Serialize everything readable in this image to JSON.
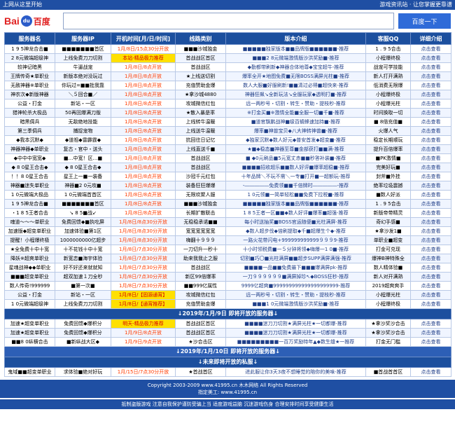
{
  "topbar": {
    "left": "上网从这里开始",
    "right": "游戏资讯站 · 让您掌握更靠谱"
  },
  "search": {
    "logo_bai": "Bai",
    "logo_paw": "du",
    "logo_du": "百度",
    "button": "百度一下",
    "placeholder": ""
  },
  "table": {
    "headers": [
      "服务器名",
      "服务器IP",
      "开机时间[月/日/时间]",
      "线路类别",
      "版本介绍",
      "客服QQ",
      "详细介绍"
    ],
    "rows": [
      [
        "1 9 5神龙合击■",
        "■■■■■■■首区",
        "1月/8日/15点30分开放",
        "■■■沙城独金",
        "■■■■■独家版本■■品牌版■■■■■■-推荐",
        "1 . 9 5合击",
        "点击查看"
      ],
      [
        "2 8元微端超级神",
        "上线免费刀刀切割",
        "本站-精品极力推荐",
        "首战战区首区",
        "■■■2 8元微端激情版沙洪奖励■-推荐",
        "小程爆终极",
        "点击查看"
      ],
      [
        "较神记暗黑",
        "牛逼战宠",
        "1月/8日/8点开放",
        "首战战区",
        "◆勤都带刷新◆神器合体地尊◆宝宝超牛-推荐",
        "战宠可学技能",
        "点击查看"
      ],
      [
        "王牌传奇★单职业",
        "新版本绝对没玩过",
        "1月/8日/8点开放",
        "★上线送切割",
        "爆率全开★地图免费■无限BOSS满屏光柱■-推荐",
        "新人打开满熟",
        "点击查看"
      ],
      [
        "无赦神器※单职业",
        "你玩过=■■批我靠",
        "1月/8日/8点开放",
        "充值赞助金爆",
        "数人大服■好服刷新!■■清过必得■超快来-推荐",
        "低消费无限爆",
        "点击查看"
      ],
      [
        "神农次◆新版神器",
        "＼５回合■／",
        "1月/8日/8点开放",
        "★拿沙城4880",
        "神器狂飙↘全新玩法↘全服玩家◆透明打■-推荐",
        "小程爆终极",
        "点击查看"
      ],
      [
        "公益・打金",
        "新站・一区",
        "1月/8日/8点开放",
        "攻城微信红包",
        "远一两秒号・切割・转生・赞助・提枝秒-推荐",
        "小程爆光柱",
        "点击查看"
      ],
      [
        "猎神轮杀大极品",
        "50再回爆满刀版",
        "1月/8日/8点开放",
        "★散入暴是率",
        "※打金买■※激情全能■全服一切■千■-推荐",
        "时间换取一切",
        "点击查看"
      ],
      [
        "暗黑倜兵",
        "无敌绝地技能",
        "1月/8日/8点开放",
        "上线转牛温暖",
        "■道官飘鹏战神■级百蜻蜂速加持■-推荐",
        "■ 8倍充值■",
        "点击查看"
      ],
      [
        "第三季倜兵",
        "捕捉宠物",
        "1月/8日/8点开放",
        "上线送牛温暖",
        "爆率■神兽宝贝◆八大神转神兽■-推荐",
        "火爆人气",
        "点击查看"
      ],
      [
        "◆我本沉默◆",
        "◆道祖◆雷霹霆◆",
        "1月/8日/8点开放",
        "抗回往日记忆",
        "◆独家沉默◆数人好元◆普安首发◆超变■-推荐",
        "稳定长期顺玩",
        "点击查看"
      ],
      [
        "神器神器◆单职业",
        "复古・官中・送头",
        "1月/8日/8点开放",
        "上线直送千■",
        "★■◆稳态■神器至尊■金部获打■■满-推荐",
        "提升百倍爆率",
        "点击查看"
      ],
      [
        "◆中中中宽宽◆",
        "■…中宽！区…■",
        "1月/8日/8点开放",
        "首战战区",
        "■ ◆0元刷品■5元宽丈赤■■秒答补装■-推荐",
        "■PK激情■",
        "点击查看"
      ],
      [
        "◆ 8 0星王合击◆",
        "◆ 8 0星王合击◆",
        "1月/8日/8点开放",
        "首战战区",
        "■■■■招收超乐■■数人好评■爆率超稳■-推荐",
        "完美好玩■",
        "点击查看"
      ],
      [
        "！！8 0星王合击",
        "星王上一■一装备",
        "1月/8日/8点开放",
        "沙冠千元红包",
        "十年品牌＼不玩不需＼一专■打开■一超额玩-推荐",
        "封斧■外挂",
        "点击查看"
      ],
      [
        "神器■迷失单职业",
        "神器■2 0元攻■",
        "1月/8日/8点开放",
        "装备狂狂爆爆",
        "-―――――免费领■■千倍牌时―――――-推荐",
        "绝率垃圾震撼",
        "点击查看"
      ],
      [
        "1 0元微端大极品",
        "1 0元微端首首区",
        "1月/8日/8点开放",
        "无限欢聚人服",
        "1 0元领■一简单轻松■■免费下拉税■-推荐",
        "■数人好派",
        "点击查看"
      ],
      [
        "1 9 5神龙合击■",
        "■■■■■■■首区",
        "1月/8日/8点开放",
        "■■■沙城独金",
        "■■■■■独家版本■■品牌版■■■■■■-推荐",
        "1 . 9 5合击",
        "点击查看"
      ],
      [
        "・1 8 5王者合击",
        "↘ 8 5■战↙",
        "1月/8日/8点开放",
        "长期扩散联击",
        "1 8 5王者一区■■◆数人好评■爆率■超强-推荐",
        "新版帝带精灵",
        "点击查看"
      ],
      [
        "魂道～～～单职业",
        "免费回馈◆■执吃屏",
        "1月/8日/8点30分开放",
        "无稳稳承诺■■",
        "每小时送抽奖■BOSS官运随便■光柱满屏-推荐",
        "奇幻手感■",
        "点击查看"
      ],
      [
        "加速版◆超变单职业",
        "加速体验■第1区",
        "1月/8日/8点30分开放",
        "宽宽宽宽宽宽",
        "◆数人超步伐◆倍刷提取◆千■超爆生个◆-推荐",
        "★拿沙发1■",
        "点击查看"
      ],
      [
        "提醒！小程爆终极",
        "1000000000亿超步",
        "1月/8日/8点30分开放",
        "嗨翻十９９９",
        "一路火花带闪电+999999999999９９９9-推荐",
        "单职业■超变",
        "点击查看"
      ],
      [
        "★全免费十中十宽",
        "十不花钱十中十宽",
        "1月/8日/7点30分开放",
        "一刀切升一秒十",
        "十小时领税费■一５分钟将领◆嗨爆一1 0■-推荐",
        "打金可兑现",
        "点击查看"
      ],
      [
        "降妖※超爽单职业",
        "新宽恋■海宇体验",
        "1月/8日/7点30分开放",
        "助来我我止之服",
        "切割■巧〇■光柱满屏■■超步SUPP满屏满强-推荐",
        "爆神B神特殊全",
        "点击查看"
      ],
      [
        "星魂战神◆◆单职业",
        "好不好还来就就知",
        "1月/8日/7点30分开放",
        "首战战区",
        "■■■■一品■■免费最下■■■爆满屏pk-推荐",
        "数人精体验■",
        "点击查看"
      ],
      [
        "■■■超变单职业",
        "超双加速１刀全秒",
        "1月/8日/7点30分开放",
        "新区99倍爆率",
        "一刀９９９９９９■满屏掉珍↖◆BOSS狂秒-推荐",
        "新人对开满熟",
        "点击查看"
      ],
      [
        "数人传奇!999999",
        "■第一次■",
        "1月/8日/7点30分开放",
        "■■999亿属性",
        "9999亿超爽■999999999999999999999-推荐",
        "2019超爽爽手",
        "点击查看"
      ],
      [
        "公益・打金",
        "新站・一区",
        "1月/8日/【固源通宵】",
        "攻城微信红包",
        "远一两秒号・切割・转生・赞助・提枝秒-推荐",
        "小程爆光柱",
        "点击查看"
      ],
      [
        "1 0元微端超级神",
        "上线免费刀刀切割",
        "1月/8日/【通宵推荐】",
        "充值赞助金爆",
        "■■■1 0元微端激情版沙洪奖励■-推荐",
        "小程爆终极",
        "点击查看"
      ]
    ],
    "section1": "↓2019年/1月/9日  即将开放的服务器↓",
    "rows2": [
      [
        "加速★超变单职业",
        "免费回馈◆爆积分",
        "明天-精品极力推荐",
        "首战战区首区",
        "■■■■迷刀刀切割★满屏光柱★一切都爆-推荐",
        "★拿沙奖沙合击",
        "点击查看"
      ],
      [
        "加速★超变单职业",
        "免费回馈◆爆积分",
        "1月/9日/8点开放",
        "首战战区首区",
        "■■■■迷刀刀切割★满屏光柱★一切都爆-推荐",
        "★拿沙奖沙合击",
        "点击查看"
      ],
      [
        "■■8 0纵横合击",
        "■新纵战大区◆",
        "1月/9日/9点开放",
        "★沙合击区",
        "■■■■■■■■■一百万奖励特年▲◆数生缝★一推荐",
        "打金无门槛",
        "点击查看"
      ]
    ],
    "section2": "↓2019年/1月/10日  即将开放的服务器↓",
    "section3": "↓未来即将开放的私服↓",
    "rows3": [
      [
        "鬼域■■超变单职业",
        "求体验■绝对好玩",
        "1月/15日/7点30分开放",
        "★首战首区",
        "进此服让你3天3夜不想睡觉的陪你的美味-推荐",
        "■首战首首区",
        "点击查看"
      ]
    ]
  },
  "footer": {
    "line1": "Copyright 2003-2009  www.41995.cn 木木网络  All Rights Reserved",
    "line2": "指定美工: www.41995.cn",
    "line3": "抵制盗版游戏 注意自我保护谨防受骗上当 适度游戏益脑 沉迷游戏伤身 合理安排时间享受健康生活"
  }
}
